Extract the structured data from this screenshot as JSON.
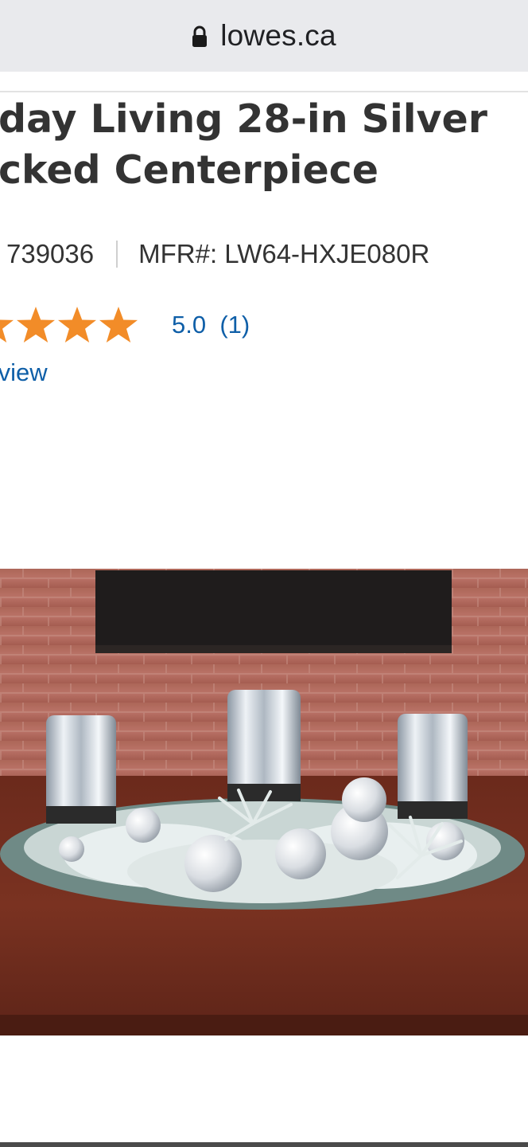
{
  "browser": {
    "url": "lowes.ca",
    "lock_icon": "lock-icon"
  },
  "product": {
    "title_line1": "day Living 28-in Silver",
    "title_line2": "cked Centerpiece",
    "item_number": "739036",
    "mfr_label": "MFR#: LW64-HXJE080R",
    "rating": "5.0",
    "review_count": "(1)",
    "stars_filled": 5,
    "star_color": "#f28c28",
    "link_color": "#0f5fa8",
    "review_link": "review"
  }
}
